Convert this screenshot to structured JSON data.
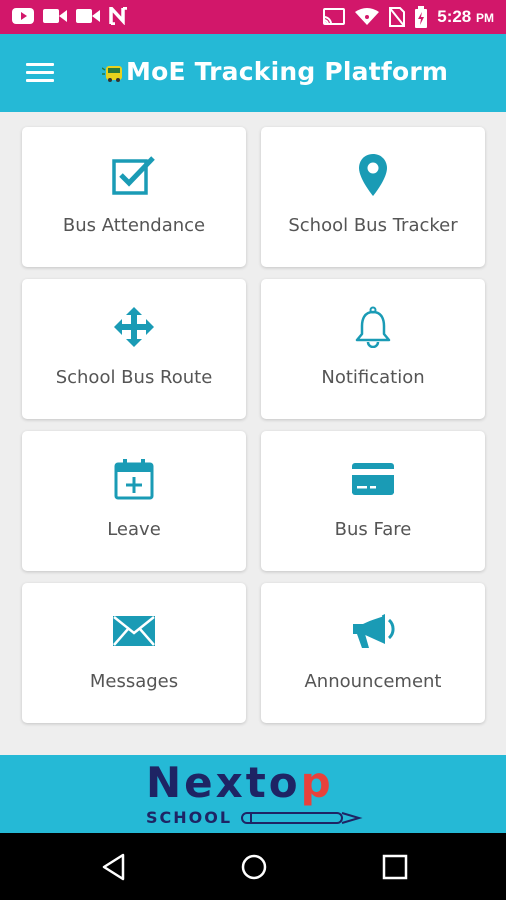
{
  "status_bar": {
    "time": "5:28",
    "ampm": "PM",
    "notification_icons": [
      "youtube-icon",
      "video-camera-icon",
      "video-camera-icon",
      "n-app-icon"
    ],
    "system_icons": [
      "cast-icon",
      "wifi-icon",
      "no-sim-icon",
      "battery-icon"
    ]
  },
  "app_bar": {
    "title": "MoE Tracking Platform",
    "menu_icon": "hamburger-menu-icon",
    "logo_icon": "bus-logo-icon"
  },
  "menu": {
    "items": [
      {
        "label": "Bus Attendance",
        "icon": "checkbox-icon"
      },
      {
        "label": "School Bus Tracker",
        "icon": "location-pin-icon"
      },
      {
        "label": "School Bus Route",
        "icon": "move-arrows-icon"
      },
      {
        "label": "Notification",
        "icon": "bell-icon"
      },
      {
        "label": "Leave",
        "icon": "calendar-add-icon"
      },
      {
        "label": "Bus Fare",
        "icon": "credit-card-icon"
      },
      {
        "label": "Messages",
        "icon": "envelope-icon"
      },
      {
        "label": "Announcement",
        "icon": "megaphone-icon"
      }
    ]
  },
  "banner": {
    "brand_main": "Nexto",
    "brand_accent": "p",
    "brand_sub": "SCHOOL"
  },
  "colors": {
    "status_bar": "#d2176a",
    "primary": "#25b9d6",
    "icon": "#1a9bb5",
    "brand_navy": "#1e2464",
    "brand_red": "#e8413c"
  },
  "nav_bar": {
    "buttons": [
      "back-icon",
      "home-icon",
      "recents-icon"
    ]
  }
}
